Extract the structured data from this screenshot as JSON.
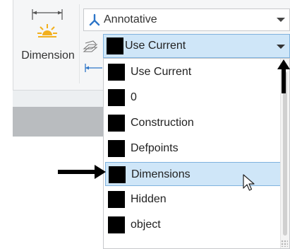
{
  "ribbon": {
    "dimension_label": "Dimension",
    "dim_style": {
      "value": "Annotative"
    },
    "layer": {
      "value": "Use Current"
    }
  },
  "layer_dropdown": {
    "items": [
      {
        "label": "Use Current",
        "swatch_color": "#000000"
      },
      {
        "label": "0",
        "swatch_color": "#000000"
      },
      {
        "label": "Construction",
        "swatch_color": "#000000"
      },
      {
        "label": "Defpoints",
        "swatch_color": "#000000"
      },
      {
        "label": "Dimensions",
        "swatch_color": "#000000"
      },
      {
        "label": "Hidden",
        "swatch_color": "#000000"
      },
      {
        "label": "object",
        "swatch_color": "#000000"
      }
    ],
    "highlighted_index": 4
  },
  "colors": {
    "highlight_bg": "#cfe6f8",
    "highlight_border": "#7fb2de",
    "annotation_arrow": "#000000",
    "dimension_icon_accent": "#f2b01e"
  },
  "icons": {
    "dimension": "dimension-sun-icon",
    "annotative": "annotative-scale-icon",
    "layer": "layer-stack-icon",
    "small_dimension": "linear-dimension-icon",
    "combo_arrow": "chevron-down-icon"
  }
}
